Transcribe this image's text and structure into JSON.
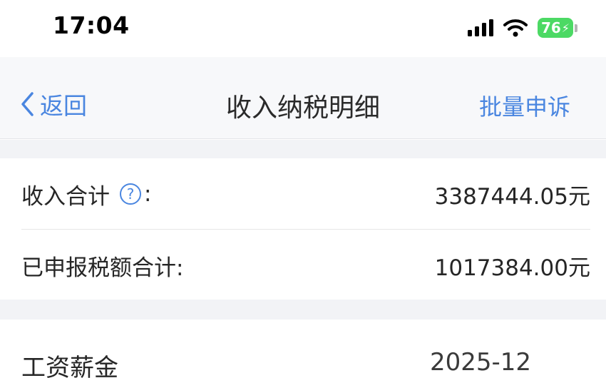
{
  "status_bar": {
    "time": "17:04",
    "battery": "76"
  },
  "nav": {
    "back_label": "返回",
    "title": "收入纳税明细",
    "action_label": "批量申诉"
  },
  "summary": {
    "income_label": "收入合计",
    "income_colon": ":",
    "income_value": "3387444.05元",
    "tax_label": "已申报税额合计:",
    "tax_value": "1017384.00元"
  },
  "list": [
    {
      "category": "工资薪金",
      "date": "2025-12"
    }
  ],
  "colors": {
    "accent": "#4a86e0",
    "battery_green": "#4cd964",
    "section_gap": "#f2f3f6"
  }
}
